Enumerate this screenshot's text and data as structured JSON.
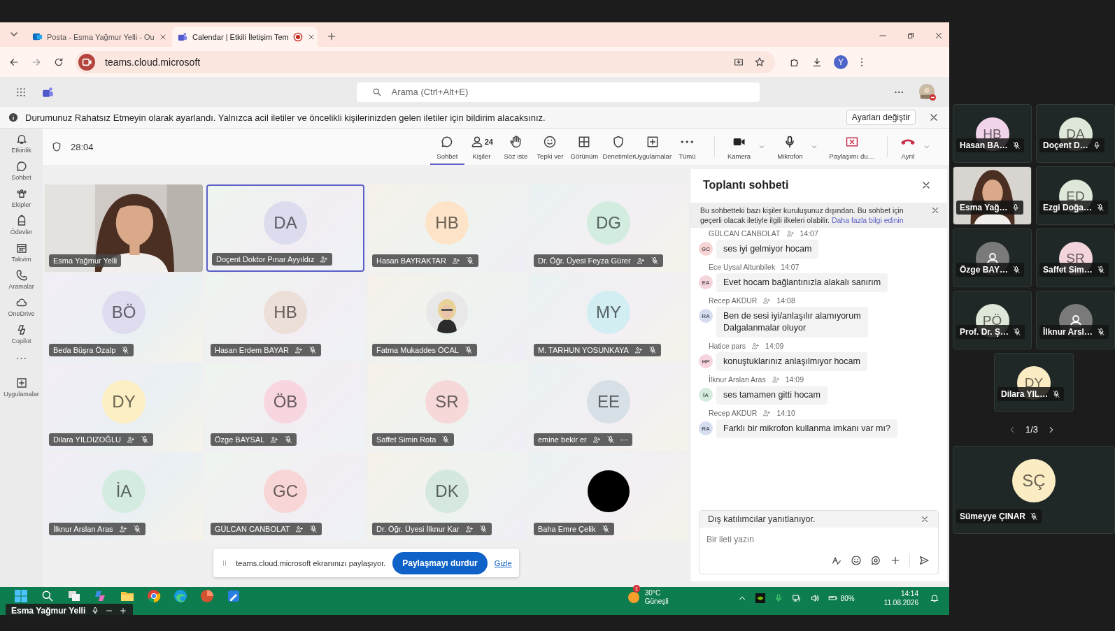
{
  "browser": {
    "tabs": [
      {
        "title": "Posta - Esma Yağmur Yelli - Ou",
        "selected": false,
        "recording": false
      },
      {
        "title": "Calendar | Etkili İletişim Tem",
        "selected": true,
        "recording": true
      }
    ],
    "url": "teams.cloud.microsoft",
    "profile": "Y"
  },
  "teams": {
    "search_placeholder": "Arama (Ctrl+Alt+E)"
  },
  "notice": {
    "text": "Durumunuz Rahatsız Etmeyin olarak ayarlandı. Yalnızca acil iletiler ve öncelikli kişilerinizden gelen iletiler için bildirim alacaksınız.",
    "button": "Ayarları değiştir"
  },
  "rail": [
    {
      "label": "Etkinlik"
    },
    {
      "label": "Sohbet"
    },
    {
      "label": "Ekipler"
    },
    {
      "label": "Ödevler"
    },
    {
      "label": "Takvim"
    },
    {
      "label": "Aramalar"
    },
    {
      "label": "OneDrive"
    },
    {
      "label": "Copilot"
    },
    {
      "label": "···"
    },
    {
      "label": "Uygulamalar"
    }
  ],
  "meeting": {
    "timer": "28:04",
    "toolbar": [
      {
        "label": "Sohbet",
        "selected": true
      },
      {
        "label": "Kişiler",
        "badge": "24",
        "selected": false
      },
      {
        "label": "Söz iste",
        "selected": false
      },
      {
        "label": "Tepki ver",
        "selected": false
      },
      {
        "label": "Görünüm",
        "selected": false
      },
      {
        "label": "Denetimler",
        "selected": false
      },
      {
        "label": "Uygulamalar",
        "selected": false
      },
      {
        "label": "Tümü",
        "selected": false
      }
    ],
    "devices": [
      {
        "label": "Kamera",
        "caret": true
      },
      {
        "label": "Mikrofon",
        "caret": true
      },
      {
        "label": "Paylaşımı du…",
        "caret": false
      }
    ],
    "leave": "Ayrıl"
  },
  "tiles": [
    {
      "name": "Esma Yağmur Yelli",
      "kind": "video",
      "ext": false,
      "muted": false,
      "speaking": false
    },
    {
      "name": "Doçent Doktor Pınar Ayyıldız",
      "kind": "avatar",
      "initials": "DA",
      "color": "#dcdcee",
      "ext": true,
      "muted": false,
      "speaking": true
    },
    {
      "name": "Hasan BAYRAKTAR",
      "kind": "avatar",
      "initials": "HB",
      "color": "#fde4c8",
      "ext": true,
      "muted": true,
      "speaking": false
    },
    {
      "name": "Dr. Öğr. Üyesi Feyza Gürer",
      "kind": "avatar",
      "initials": "DG",
      "color": "#d2ecdf",
      "ext": true,
      "muted": true,
      "speaking": false
    },
    {
      "name": "Beda Büşra Özalp",
      "kind": "avatar",
      "initials": "BÖ",
      "color": "#e0dcf0",
      "ext": false,
      "muted": true,
      "speaking": false
    },
    {
      "name": "Hasan Erdem BAYAR",
      "kind": "avatar",
      "initials": "HB",
      "color": "#ecdfd8",
      "ext": true,
      "muted": true,
      "speaking": false
    },
    {
      "name": "Fatma Mukaddes ÖCAL",
      "ext": false,
      "muted": true,
      "speaking": false
    },
    {
      "name": "M. TARHUN YOSUNKAYA",
      "kind": "avatar",
      "initials": "MY",
      "color": "#d2eef2",
      "ext": true,
      "muted": true,
      "speaking": false
    },
    {
      "name": "Dilara YILDIZOĞLU",
      "kind": "avatar",
      "initials": "DY",
      "color": "#fdefc4",
      "ext": true,
      "muted": true,
      "speaking": false
    },
    {
      "name": "Özge BAYSAL",
      "kind": "avatar",
      "initials": "ÖB",
      "color": "#f8d6e0",
      "ext": true,
      "muted": true,
      "speaking": false
    },
    {
      "name": "Saffet Simin Rota",
      "kind": "avatar",
      "initials": "SR",
      "color": "#f6d8d8",
      "ext": false,
      "muted": true,
      "speaking": false
    },
    {
      "name": "emine bekir er",
      "kind": "avatar",
      "initials": "EE",
      "color": "#d6e0e6",
      "ext": true,
      "muted": true,
      "speaking": false,
      "more": "···"
    },
    {
      "name": "İlknur Arslan Aras",
      "kind": "avatar",
      "initials": "İA",
      "color": "#d4ecdf",
      "ext": true,
      "muted": true,
      "speaking": false
    },
    {
      "name": "GÜLCAN CANBOLAT",
      "kind": "avatar",
      "initials": "GC",
      "color": "#f8d6d6",
      "ext": true,
      "muted": true,
      "speaking": false
    },
    {
      "name": "Dr. Öğr. Üyesi İlknur Kar",
      "kind": "avatar",
      "initials": "DK",
      "color": "#d4e8de",
      "ext": true,
      "muted": true,
      "speaking": false
    },
    {
      "name": "Baha Emre Çelik",
      "kind": "dark",
      "ext": false,
      "muted": true,
      "speaking": false
    }
  ],
  "share_bar": {
    "text": "teams.cloud.microsoft ekranınızı paylaşıyor.",
    "button": "Paylaşmayı durdur",
    "link": "Gizle"
  },
  "chat": {
    "title": "Toplantı sohbeti",
    "banner": "Bu sohbetteki bazı kişiler kuruluşunuz dışından. Bu sohbet için geçerli olacak iletiyle ilgili ilkeleri olabilir.",
    "banner_link": "Daha fazla bilgi edinin",
    "messages": [
      {
        "author": "GÜLCAN CANBOLAT",
        "ext": true,
        "time": "14:07",
        "initials": "GC",
        "color": "#f6d4d4",
        "lines": [
          "ses iyi gelmiyor hocam"
        ]
      },
      {
        "author": "Ece Uysal Altunbilek",
        "ext": false,
        "time": "14:07",
        "initials": "EA",
        "color": "#f6d4dc",
        "lines": [
          "Evet hocam bağlantınızla alakalı sanırım"
        ]
      },
      {
        "author": "Recep AKDUR",
        "ext": true,
        "time": "14:08",
        "initials": "RA",
        "color": "#d4def0",
        "lines": [
          "Ben de sesi iyi/anlaşılır alamıyorum",
          "Dalgalanmalar oluyor"
        ]
      },
      {
        "author": "Hatice pars",
        "ext": true,
        "time": "14:09",
        "initials": "HP",
        "color": "#f6d4de",
        "lines": [
          "konuştuklarınız anlaşılmıyor hocam"
        ]
      },
      {
        "author": "İlknur Arslan Aras",
        "ext": true,
        "time": "14:09",
        "initials": "İA",
        "color": "#d4ecde",
        "lines": [
          "ses tamamen gitti hocam"
        ]
      },
      {
        "author": "Recep AKDUR",
        "ext": true,
        "time": "14:10",
        "initials": "RA",
        "color": "#d4def0",
        "lines": [
          "Farklı bir mikrofon kullanma imkanı var mı?"
        ]
      }
    ],
    "reply_banner": "Dış katılımcılar yanıtlanıyor.",
    "placeholder": "Bir ileti yazın"
  },
  "taskbar": {
    "weather_badge": "1",
    "temperature": "30°C",
    "weather": "Güneşli",
    "battery": "80%",
    "time": "14:14",
    "date": "11.08.2026"
  },
  "presenter": {
    "name": "Esma Yağmur Yelli"
  },
  "side": {
    "tiles": [
      {
        "name": "Hasan BA…",
        "kind": "avatar",
        "initials": "HB",
        "color": "#f2d4ea",
        "muted": true
      },
      {
        "name": "Doçent D…",
        "kind": "avatar",
        "initials": "DA",
        "color": "#dfe8d8",
        "muted": false
      },
      {
        "name": "Esma Yağ…",
        "kind": "video",
        "muted": false
      },
      {
        "name": "Ezgi Doğa…",
        "kind": "avatar",
        "initials": "ED",
        "color": "#dfe8d8",
        "muted": true
      },
      {
        "name": "Özge BAY…",
        "kind": "person",
        "muted": true
      },
      {
        "name": "Saffet Sim…",
        "kind": "avatar",
        "initials": "SR",
        "color": "#f2d4dc",
        "muted": true
      },
      {
        "name": "Prof. Dr. Ş…",
        "kind": "avatar",
        "initials": "PÖ",
        "color": "#dfe8d8",
        "muted": true
      },
      {
        "name": "İlknur Arsl…",
        "kind": "person",
        "muted": true
      },
      {
        "name": "Dilara YIL…",
        "kind": "avatar",
        "initials": "DY",
        "color": "#fbecc4",
        "muted": true
      }
    ],
    "pager": "1/3",
    "featured": {
      "name": "Sümeyye ÇINAR",
      "initials": "SÇ",
      "color": "#fbecc4",
      "muted": true
    }
  }
}
